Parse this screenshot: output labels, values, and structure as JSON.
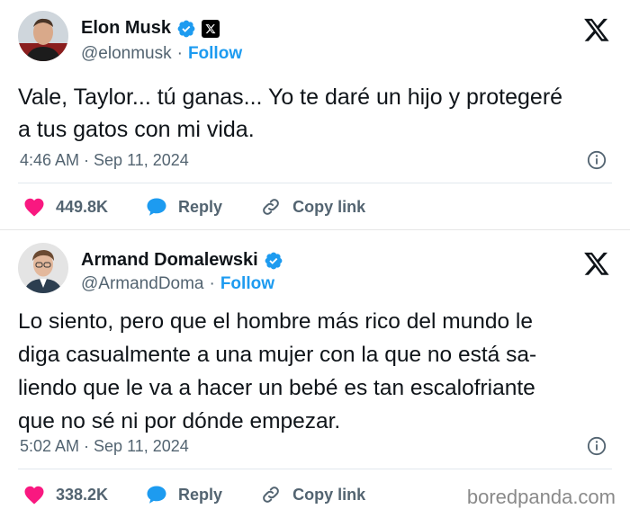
{
  "tweets": [
    {
      "name": "Elon Musk",
      "handle": "@elonmusk",
      "follow_label": "Follow",
      "text_lines": [
        "Vale, Taylor... tú ganas... Yo te daré un hijo y protegeré",
        "a tus gatos con mi vida."
      ],
      "timestamp": "4:46 AM · Sep 11, 2024",
      "likes": "449.8K",
      "reply_label": "Reply",
      "copy_label": "Copy link"
    },
    {
      "name": "Armand Domalewski",
      "handle": "@ArmandDoma",
      "follow_label": "Follow",
      "text_lines": [
        "Lo siento, pero que el hombre más rico del mundo le",
        "diga casualmente a una mujer con la que no está sa-",
        "liendo que le va a hacer un bebé es tan escalofriante",
        "que no sé ni por dónde empezar."
      ],
      "timestamp": "5:02 AM · Sep 11, 2024",
      "likes": "338.2K",
      "reply_label": "Reply",
      "copy_label": "Copy link"
    }
  ],
  "separator_dot": "·",
  "watermark": "boredpanda.com",
  "colors": {
    "accent": "#1d9bf0",
    "like": "#f91880",
    "text": "#0f1419",
    "muted": "#536471"
  }
}
